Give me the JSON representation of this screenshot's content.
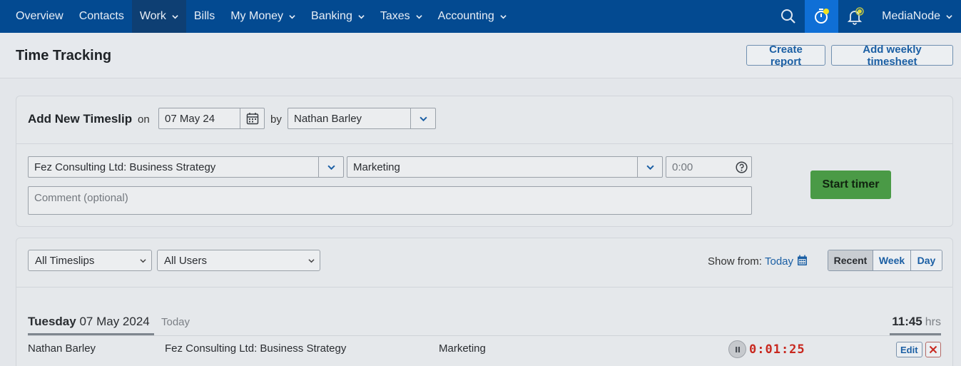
{
  "nav": {
    "items": [
      {
        "label": "Overview",
        "dropdown": false
      },
      {
        "label": "Contacts",
        "dropdown": false
      },
      {
        "label": "Work",
        "dropdown": true,
        "active": true
      },
      {
        "label": "Bills",
        "dropdown": false
      },
      {
        "label": "My Money",
        "dropdown": true
      },
      {
        "label": "Banking",
        "dropdown": true
      },
      {
        "label": "Taxes",
        "dropdown": true
      },
      {
        "label": "Accounting",
        "dropdown": true
      }
    ],
    "account": "MediaNode",
    "accent_color": "#034a91",
    "badge_color": "#f2e21c"
  },
  "header": {
    "title": "Time Tracking",
    "create_report": "Create report",
    "add_weekly": "Add weekly timesheet"
  },
  "new_timeslip": {
    "title": "Add New Timeslip",
    "on_label": "on",
    "date": "07 May 24",
    "by_label": "by",
    "user": "Nathan Barley",
    "project": "Fez Consulting Ltd: Business Strategy",
    "task": "Marketing",
    "hours_placeholder": "0:00",
    "comment_placeholder": "Comment (optional)",
    "start_timer": "Start timer"
  },
  "filters": {
    "timeslips": "All Timeslips",
    "users": "All Users",
    "show_from_label": "Show from:",
    "show_from_value": "Today",
    "views": [
      "Recent",
      "Week",
      "Day"
    ],
    "active_view": "Recent"
  },
  "day_group": {
    "weekday": "Tuesday",
    "date": "07 May 2024",
    "today_label": "Today",
    "total": "11:45",
    "total_unit": "hrs",
    "entries": [
      {
        "user": "Nathan Barley",
        "client": "Fez Consulting Ltd",
        "project": "Business Strategy",
        "task": "Marketing",
        "timer": "0:01:25",
        "edit_label": "Edit"
      }
    ]
  }
}
